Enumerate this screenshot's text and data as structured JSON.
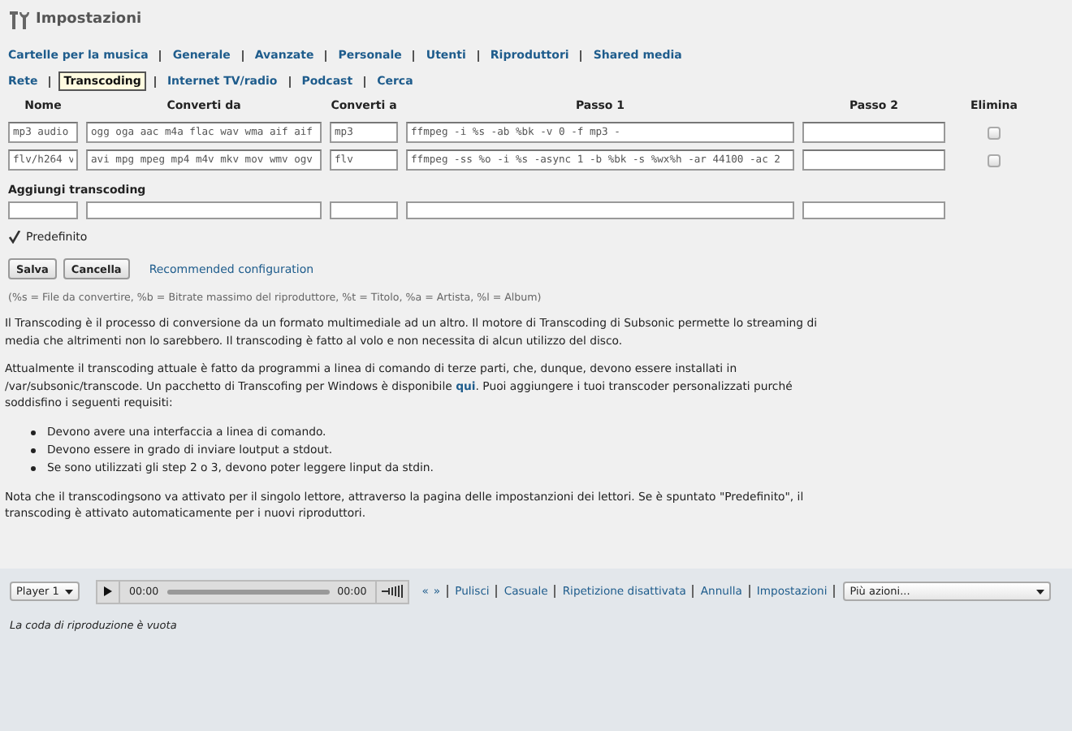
{
  "window": {
    "title": "Impostazioni"
  },
  "nav": [
    [
      {
        "label": "Cartelle per la musica",
        "selected": false
      },
      {
        "label": "Generale",
        "selected": false
      },
      {
        "label": "Avanzate",
        "selected": false
      },
      {
        "label": "Personale",
        "selected": false
      },
      {
        "label": "Utenti",
        "selected": false
      },
      {
        "label": "Riproduttori",
        "selected": false
      },
      {
        "label": "Shared media",
        "selected": false
      }
    ],
    [
      {
        "label": "Rete",
        "selected": false
      },
      {
        "label": "Transcoding",
        "selected": true
      },
      {
        "label": "Internet TV/radio",
        "selected": false
      },
      {
        "label": "Podcast",
        "selected": false
      },
      {
        "label": "Cerca",
        "selected": false
      }
    ]
  ],
  "table": {
    "columns": [
      "Nome",
      "Converti da",
      "Converti a",
      "Passo 1",
      "Passo 2",
      "Elimina"
    ],
    "rows": [
      {
        "cells": [
          "mp3 audio",
          "ogg oga aac m4a flac wav wma aif aif",
          "mp3",
          "ffmpeg -i %s -ab %bk -v 0 -f mp3 -",
          ""
        ],
        "delete": false
      },
      {
        "cells": [
          "flv/h264 v",
          "avi mpg mpeg mp4 m4v mkv mov wmv ogv",
          "flv",
          "ffmpeg -ss %o -i %s -async 1 -b %bk -s %wx%h -ar 44100 -ac 2",
          ""
        ],
        "delete": false
      }
    ]
  },
  "add": {
    "title": "Aggiungi transcoding",
    "default": {
      "label": "Predefinito",
      "checked": true
    }
  },
  "buttons": [
    "Salva",
    "Cancella"
  ],
  "recommended_link": "Recommended configuration",
  "legend": "(%s = File da convertire, %b = Bitrate massimo del riproduttore, %t = Titolo, %a = Artista, %l = Album)",
  "help": {
    "p1": "Il Transcoding è il processo di conversione da un formato multimediale ad un altro. Il motore di Transcoding di Subsonic permette lo streaming di media che altrimenti non lo sarebbero. Il transcoding è fatto al volo e non necessita di alcun utilizzo del disco.",
    "p2": {
      "before": "Attualmente il transcoding attuale è fatto da programmi a linea di comando di terze parti, che, dunque, devono essere installati in /var/subsonic/transcode. Un pacchetto di Transcofing per Windows è disponibile ",
      "link": "qui",
      "after": ". Puoi aggiungere i tuoi transcoder personalizzati purché soddisfino i seguenti requisiti:"
    },
    "requirements": [
      "Devono avere una interfaccia a linea di comando.",
      "Devono essere in grado di inviare loutput a stdout.",
      "Se sono utilizzati gli step 2 o 3, devono poter leggere linput da stdin."
    ],
    "p3": "Nota che il transcodingsono va attivato per il singolo lettore, attraverso la pagina delle impostanzioni dei lettori. Se è spuntato \"Predefinito\", il transcoding è attivato automaticamente per i nuovi riproduttori."
  },
  "player": {
    "player_select": "Player 1",
    "time_start": "00:00",
    "time_end": "00:00",
    "links": [
      "«",
      "»",
      "Pulisci",
      "Casuale",
      "Ripetizione disattivata",
      "Annulla",
      "Impostazioni"
    ],
    "actions_select": "Più azioni...",
    "queue_message": "La coda di riproduzione è vuota"
  }
}
